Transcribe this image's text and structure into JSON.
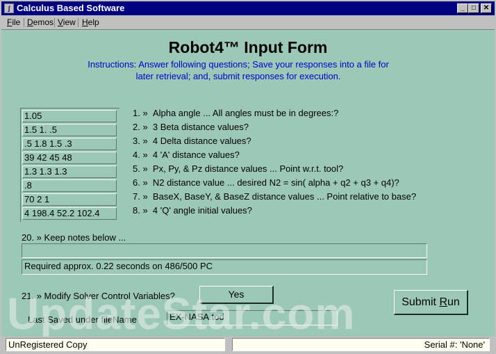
{
  "window": {
    "title": "Calculus Based Software",
    "minimize_glyph": "_",
    "maximize_glyph": "□",
    "close_glyph": "✕"
  },
  "menu": [
    {
      "label": "File",
      "accel": "F"
    },
    {
      "label": "Demos",
      "accel": "D"
    },
    {
      "label": "View",
      "accel": "V"
    },
    {
      "label": "Help",
      "accel": "H"
    }
  ],
  "form": {
    "title": "Robot4™ Input Form",
    "instructions_line1": "Instructions: Answer following questions; Save your responses into a file for",
    "instructions_line2": "later retrieval; and, submit responses for execution."
  },
  "questions": [
    {
      "number": "1. »",
      "text": "Alpha angle ... All angles must be in degrees:?",
      "answer": "1.05"
    },
    {
      "number": "2. »",
      "text": "3 Beta distance values?",
      "answer": "1.5   1.   .5"
    },
    {
      "number": "3. »",
      "text": "4 Delta distance values?",
      "answer": ".5   1.8  1.5  .3"
    },
    {
      "number": "4. »",
      "text": "4 'A' distance values?",
      "answer": "39    42   45  48"
    },
    {
      "number": "5. »",
      "text": "Px, Py, & Pz distance values ... Point w.r.t. tool?",
      "answer": "1.3    1.3  1.3"
    },
    {
      "number": "6. »",
      "text": "N2 distance value ... desired N2 = sin( alpha + q2 + q3 + q4)?",
      "answer": ".8"
    },
    {
      "number": "7. »",
      "text": "BaseX, BaseY, & BaseZ distance values ... Point relative to base?",
      "answer": "70  2   1"
    },
    {
      "number": "8. »",
      "text": "4 'Q' angle initial values?",
      "answer": "4  198.4  52.2  102.4"
    }
  ],
  "notes": {
    "label": "20. » Keep notes below ...",
    "note1": "",
    "note2": "Required approx. 0.22 seconds on 486/500 PC"
  },
  "solver": {
    "label": "21. » Modify Solver Control Variables?",
    "button": "Yes"
  },
  "submit": {
    "label_before": "Submit ",
    "label_accel": "R",
    "label_after": "un"
  },
  "last_saved": {
    "label": "Last Saved under fileName",
    "value": "EX-NASA.tod"
  },
  "status": {
    "left": "UnRegistered Copy",
    "right": "Serial #:  'None'"
  },
  "watermark": "UpdateStar.com"
}
